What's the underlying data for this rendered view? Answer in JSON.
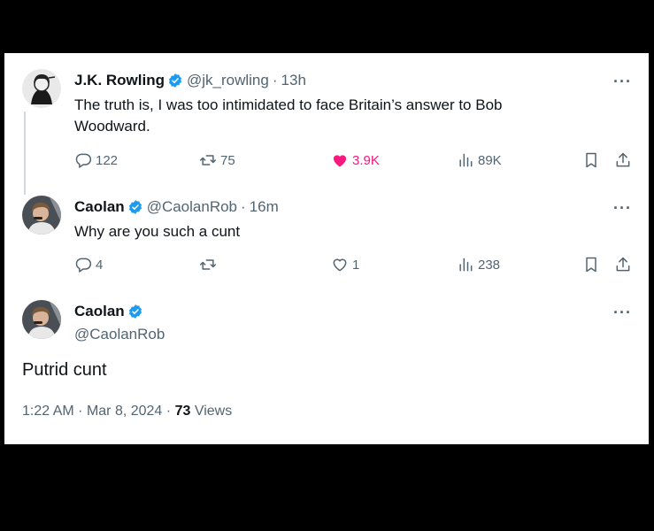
{
  "colors": {
    "verified": "#1d9bf0",
    "like": "#f91880",
    "muted": "#536471",
    "text": "#0f1419"
  },
  "tweet1": {
    "name": "J.K. Rowling",
    "handle": "@jk_rowling",
    "time": "13h",
    "text": "The truth is, I was too intimidated to face Britain’s answer to Bob Woodward.",
    "replies": "122",
    "retweets": "75",
    "likes": "3.9K",
    "views": "89K",
    "avatar_icon": "jk-rowling-avatar",
    "liked": true
  },
  "tweet2": {
    "name": "Caolan",
    "handle": "@CaolanRob",
    "time": "16m",
    "text": "Why are you such a cunt",
    "replies": "4",
    "retweets": "",
    "likes": "1",
    "views": "238",
    "avatar_icon": "caolan-avatar"
  },
  "main_tweet": {
    "name": "Caolan",
    "handle": "@CaolanRob",
    "text": "Putrid cunt",
    "time": "1:22 AM",
    "date": "Mar 8, 2024",
    "views_count": "73",
    "views_label": "Views",
    "avatar_icon": "caolan-avatar"
  },
  "ui": {
    "separator": "·",
    "more": "···"
  }
}
